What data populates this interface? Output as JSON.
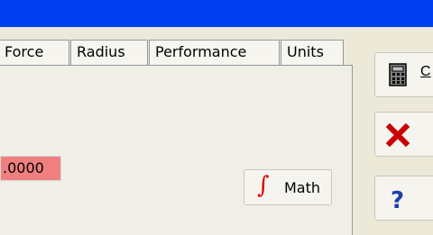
{
  "tabs": [
    {
      "label": "Force"
    },
    {
      "label": "Radius"
    },
    {
      "label": "Performance"
    },
    {
      "label": "Units"
    }
  ],
  "field": {
    "value": ".0000",
    "background": "#f08080"
  },
  "math_button": {
    "symbol": "∫",
    "label": "Math"
  },
  "side_buttons": {
    "calculator": {
      "icon": "calculator-icon",
      "label": "C"
    },
    "close": {
      "icon": "close-x-icon"
    },
    "help": {
      "icon": "help-question-icon"
    }
  },
  "colors": {
    "titlebar": "#0040f0",
    "window": "#ece9d8",
    "close_icon": "#cc0000",
    "help_icon": "#1a3fb0"
  }
}
